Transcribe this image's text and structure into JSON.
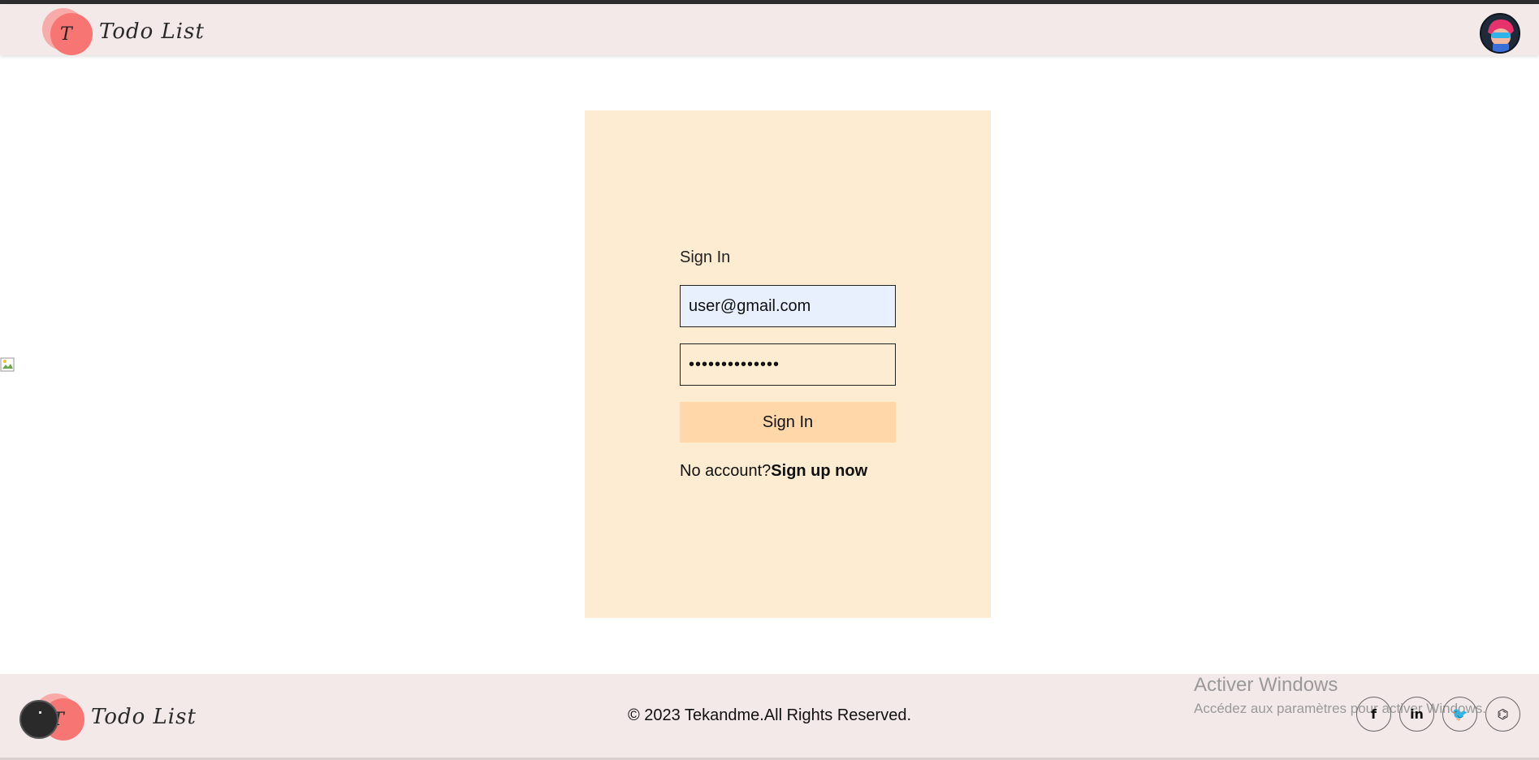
{
  "header": {
    "logo_letter": "T",
    "logo_text": "Todo List",
    "avatar_icon": "user-avatar-icon"
  },
  "signin": {
    "title": "Sign In",
    "email_value": "user@gmail.com",
    "password_value": "••••••••••••••",
    "button_label": "Sign In",
    "no_account_text": "No account?",
    "signup_link": "Sign up now"
  },
  "footer": {
    "logo_letter": "T",
    "logo_text": "Todo List",
    "copyright": "© 2023 Tekandme.All Rights Reserved.",
    "watermark_title": "Activer Windows",
    "watermark_subtitle": "Accédez aux paramètres pour activer Windows.",
    "socials": [
      {
        "icon": "facebook-icon",
        "glyph": "f"
      },
      {
        "icon": "linkedin-icon",
        "glyph": "in"
      },
      {
        "icon": "twitter-icon",
        "glyph": "🐦"
      },
      {
        "icon": "github-icon",
        "glyph": "⌬"
      }
    ]
  },
  "colors": {
    "header_bg": "#f3e9e8",
    "card_bg": "#feecd2",
    "button_bg": "#ffd7a8",
    "email_bg": "#e8f0fe",
    "logo_red": "#f77674"
  }
}
